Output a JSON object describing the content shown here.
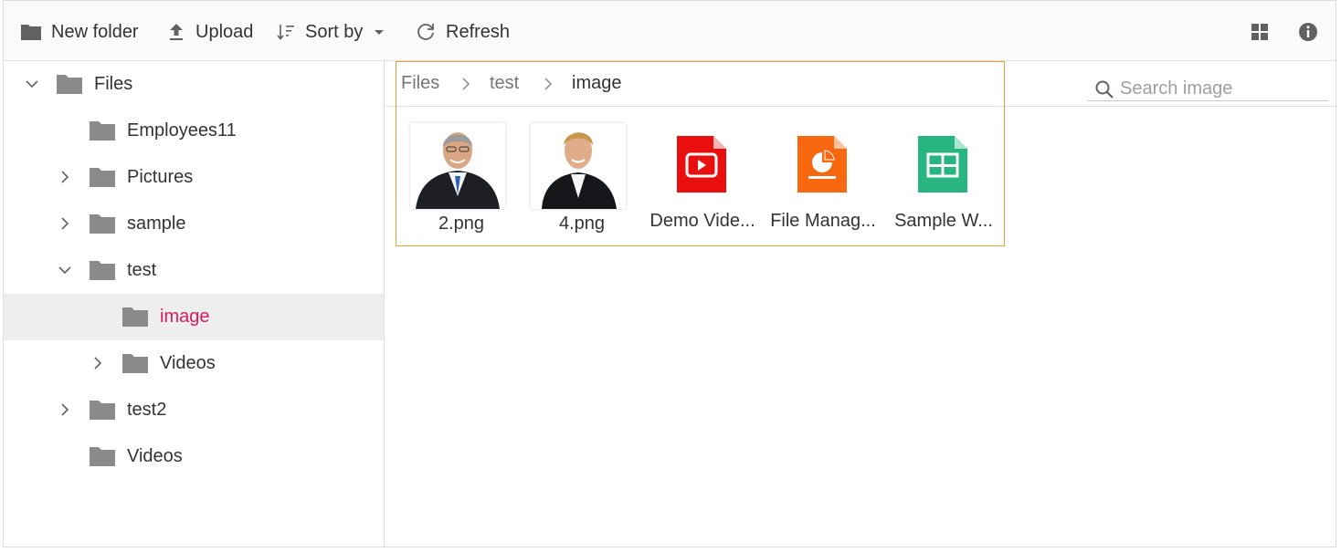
{
  "toolbar": {
    "new_folder": "New folder",
    "upload": "Upload",
    "sort_by": "Sort by",
    "refresh": "Refresh",
    "view_icon": "grid-view-icon",
    "details_icon": "info-icon"
  },
  "nav": {
    "items": [
      {
        "label": "Files",
        "expanded": true,
        "level": 0
      },
      {
        "label": "Employees11",
        "level": 1
      },
      {
        "label": "Pictures",
        "collapsed": true,
        "level": 1
      },
      {
        "label": "sample",
        "collapsed": true,
        "level": 1
      },
      {
        "label": "test",
        "expanded": true,
        "level": 1
      },
      {
        "label": "image",
        "selected": true,
        "level": 2
      },
      {
        "label": "Videos",
        "collapsed": true,
        "level": 2
      },
      {
        "label": "test2",
        "collapsed": true,
        "level": 1
      },
      {
        "label": "Videos",
        "level": 1
      }
    ]
  },
  "breadcrumb": [
    "Files",
    "test",
    "image"
  ],
  "search": {
    "placeholder": "Search image"
  },
  "files": [
    {
      "name": "2.png",
      "type": "image"
    },
    {
      "name": "4.png",
      "type": "image"
    },
    {
      "name": "Demo Vide...",
      "type": "video"
    },
    {
      "name": "File Manag...",
      "type": "presentation"
    },
    {
      "name": "Sample W...",
      "type": "spreadsheet"
    }
  ],
  "colors": {
    "selected_text": "#d81b60",
    "focus_border": "#e3a33b",
    "video": "#ea0f0f",
    "presentation": "#f7670f",
    "spreadsheet": "#29b582",
    "folder": "#8a8a8a"
  }
}
